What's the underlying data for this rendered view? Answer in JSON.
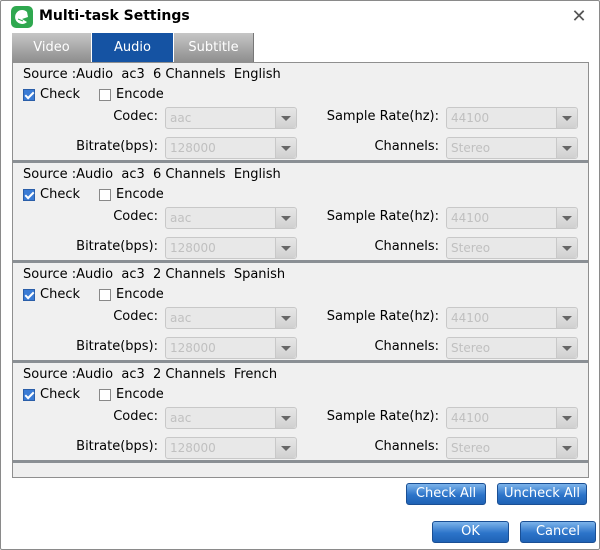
{
  "window": {
    "title": "Multi-task Settings",
    "close_icon": "close-icon",
    "app_icon": "app-logo-icon"
  },
  "tabs": [
    {
      "label": "Video",
      "active": false
    },
    {
      "label": "Audio",
      "active": true
    },
    {
      "label": "Subtitle",
      "active": false
    }
  ],
  "labels": {
    "check": "Check",
    "encode": "Encode",
    "codec": "Codec:",
    "bitrate": "Bitrate(bps):",
    "sample_rate": "Sample Rate(hz):",
    "channels": "Channels:"
  },
  "tracks": [
    {
      "source": "Source :Audio  ac3  6 Channels  English",
      "check": true,
      "encode": false,
      "codec": "aac",
      "bitrate": "128000",
      "sample_rate": "44100",
      "channels": "Stereo"
    },
    {
      "source": "Source :Audio  ac3  6 Channels  English",
      "check": true,
      "encode": false,
      "codec": "aac",
      "bitrate": "128000",
      "sample_rate": "44100",
      "channels": "Stereo"
    },
    {
      "source": "Source :Audio  ac3  2 Channels  Spanish",
      "check": true,
      "encode": false,
      "codec": "aac",
      "bitrate": "128000",
      "sample_rate": "44100",
      "channels": "Stereo"
    },
    {
      "source": "Source :Audio  ac3  2 Channels  French",
      "check": true,
      "encode": false,
      "codec": "aac",
      "bitrate": "128000",
      "sample_rate": "44100",
      "channels": "Stereo"
    }
  ],
  "buttons": {
    "check_all": "Check All",
    "uncheck_all": "Uncheck All",
    "ok": "OK",
    "cancel": "Cancel"
  }
}
